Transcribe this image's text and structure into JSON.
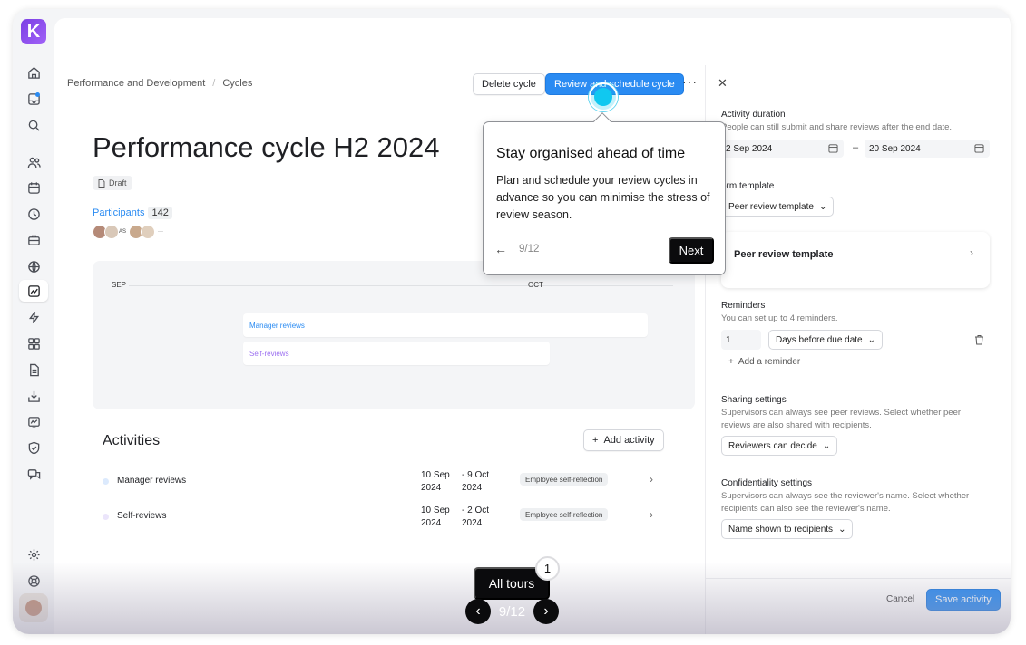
{
  "app": {
    "logo_letter": "K"
  },
  "header": {
    "breadcrumb": [
      "Performance and Development",
      "Cycles"
    ],
    "delete_label": "Delete cycle",
    "review_label": "Review and schedule cycle",
    "more_label": "···"
  },
  "cycle": {
    "title": "Performance cycle H2 2024",
    "status": "Draft",
    "participants_label": "Participants",
    "participants_count": "142",
    "avatar_initials": "AS",
    "avatar_more": "···"
  },
  "timeline": {
    "months": [
      "SEP",
      "OCT"
    ],
    "bars": [
      "Manager reviews",
      "Self-reviews"
    ]
  },
  "activities": {
    "title": "Activities",
    "add_label": "Add activity",
    "rows": [
      {
        "name": "Manager reviews",
        "start": [
          "10 Sep",
          "2024"
        ],
        "end": [
          "- 9 Oct",
          "2024"
        ],
        "tag": "Employee self-reflection"
      },
      {
        "name": "Self-reviews",
        "start": [
          "10 Sep",
          "2024"
        ],
        "end": [
          "- 2 Oct",
          "2024"
        ],
        "tag": "Employee self-reflection"
      }
    ]
  },
  "panel": {
    "duration_title": "Activity duration",
    "duration_sub": "People can still submit and share reviews after the end date.",
    "start_date": "2 Sep 2024",
    "end_date": "20 Sep 2024",
    "date_sep": "–",
    "form_title": "orm template",
    "form_select": "Peer review template",
    "form_card": "Peer review template",
    "reminders_title": "Reminders",
    "reminders_sub": "You can set up to 4 reminders.",
    "reminder_value": "1",
    "reminder_unit": "Days before due date",
    "add_reminder": "Add a reminder",
    "sharing_title": "Sharing settings",
    "sharing_sub": "Supervisors can always see peer reviews. Select whether peer reviews are also shared with recipients.",
    "sharing_select": "Reviewers can decide",
    "conf_title": "Confidentiality settings",
    "conf_sub": "Supervisors can always see the reviewer's name. Select whether recipients can also see the reviewer's name.",
    "conf_select": "Name shown to recipients",
    "cancel_label": "Cancel",
    "save_label": "Save activity"
  },
  "tour": {
    "title": "Stay organised ahead of time",
    "body": "Plan and schedule your review cycles in advance so you can minimise the stress of review season.",
    "step": "9/12",
    "next_label": "Next",
    "all_tours_label": "All tours",
    "all_tours_count": "1",
    "pager_label": "9/12"
  },
  "colors": {
    "accent": "#2a8bf2",
    "beacon": "#10c8f0",
    "brand": "#7b3fe4"
  }
}
